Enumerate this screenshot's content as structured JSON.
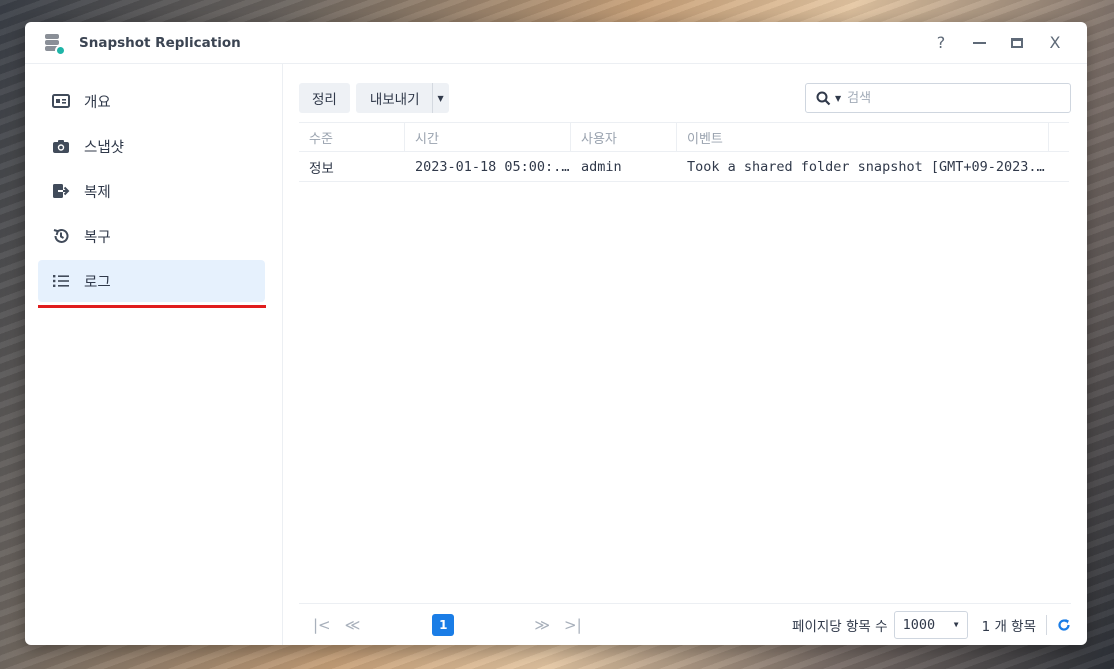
{
  "window": {
    "title": "Snapshot Replication",
    "controls": {
      "help": "?",
      "close": "X"
    }
  },
  "sidebar": {
    "items": [
      {
        "label": "개요",
        "icon": "overview-icon"
      },
      {
        "label": "스냅샷",
        "icon": "camera-icon"
      },
      {
        "label": "복제",
        "icon": "replication-icon"
      },
      {
        "label": "복구",
        "icon": "restore-icon"
      },
      {
        "label": "로그",
        "icon": "list-icon",
        "active": true
      }
    ]
  },
  "toolbar": {
    "clear_label": "정리",
    "export_label": "내보내기",
    "search_placeholder": "검색"
  },
  "table": {
    "columns": [
      "수준",
      "시간",
      "사용자",
      "이벤트"
    ],
    "rows": [
      {
        "level": "정보",
        "time": "2023-01-18 05:00:...",
        "user": "admin",
        "event": "Took a shared folder snapshot [GMT+09-2023.0..."
      }
    ]
  },
  "pager": {
    "current_page": "1",
    "per_page_label": "페이지당 항목 수",
    "per_page_value": "1000",
    "count_label": "1 개 항목"
  },
  "colors": {
    "accent": "#1a7de6",
    "active_bg": "#e6f1fd",
    "underline": "#e01d1d",
    "badge": "#1fb5a8"
  }
}
